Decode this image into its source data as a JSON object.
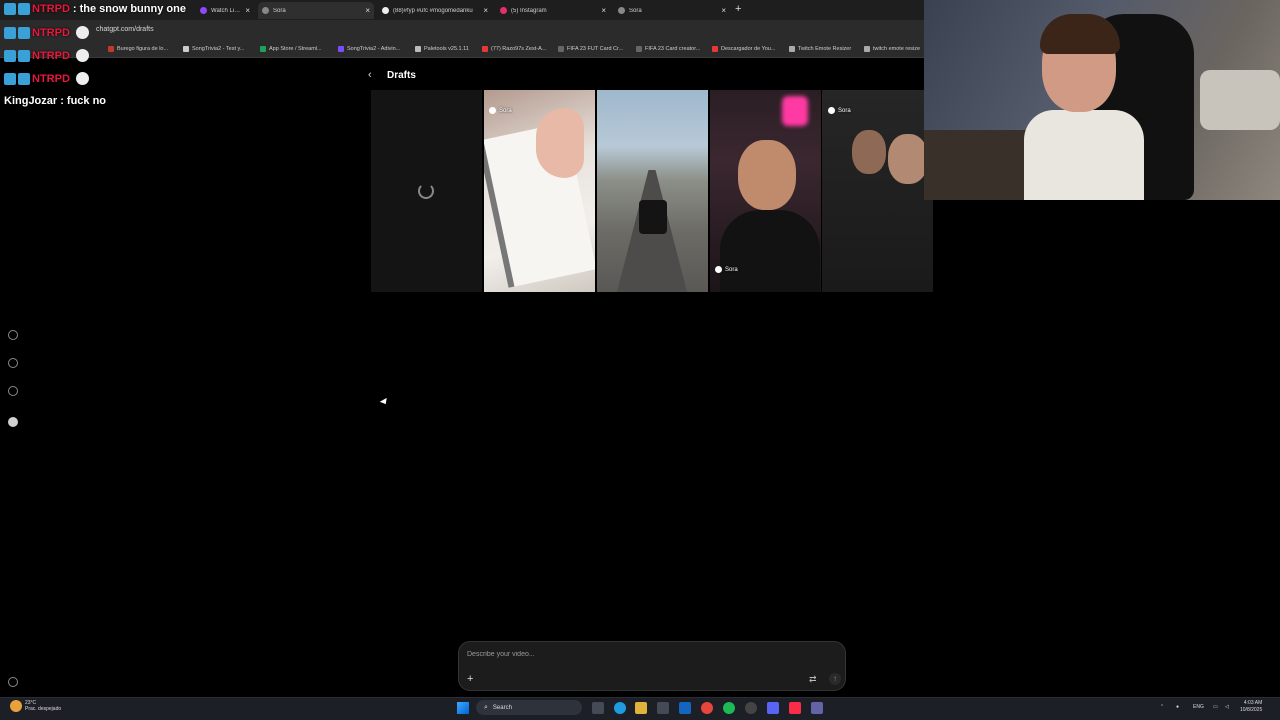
{
  "browser": {
    "tabs": [
      {
        "title": "Watch Live o",
        "color": "#9146ff"
      },
      {
        "title": "Sora",
        "color": "#888888"
      },
      {
        "title": "(88)#fyp #ufc #mogomedanku",
        "color": "#eeeeee"
      },
      {
        "title": "(5) Instagram",
        "color": "#e1306c"
      },
      {
        "title": "Sora",
        "color": "#888888"
      }
    ],
    "new_tab": "+",
    "url": "chatgpt.com/drafts",
    "bookmarks": [
      {
        "label": "Burego figura de lo...",
        "color": "#c0392b"
      },
      {
        "label": "SongTrivia2 - Test y...",
        "color": "#cccccc"
      },
      {
        "label": "App Store / Streaml...",
        "color": "#1aa35c"
      },
      {
        "label": "SongTrivia2 - Adivin...",
        "color": "#7c4dff"
      },
      {
        "label": "Paletools v25.1.11",
        "color": "#bbbbbb"
      },
      {
        "label": "(77) Razo97s Zest-A...",
        "color": "#e53935"
      },
      {
        "label": "FIFA 23 FUT Card Cr...",
        "color": "#666666"
      },
      {
        "label": "FIFA 23 Card creator...",
        "color": "#666666"
      },
      {
        "label": "Descargador de You...",
        "color": "#e53935"
      },
      {
        "label": "Twitch Emote Resizer",
        "color": "#aaaaaa"
      },
      {
        "label": "twitch emote resize",
        "color": "#aaaaaa"
      }
    ]
  },
  "chat": {
    "messages": [
      {
        "user": "NTRPD",
        "text": ": the snow bunny one"
      },
      {
        "user": "NTRPD",
        "text": ""
      },
      {
        "user": "NTRPD",
        "text": ""
      },
      {
        "user": "NTRPD",
        "text": ""
      },
      {
        "user": "KingJozar",
        "text": ": fuck no"
      }
    ]
  },
  "app": {
    "back_icon": "chevron-left-icon",
    "title": "Drafts",
    "watermark": "Sora",
    "composer": {
      "placeholder": "Describe your video...",
      "plus": "+",
      "settings": "⇄",
      "send": "↑"
    }
  },
  "taskbar": {
    "weather_temp": "23°C",
    "weather_desc": "Prac. despejado",
    "search_label": "Search",
    "language": "ENG",
    "time": "4:03 AM",
    "date": "10/8/2025",
    "apps": [
      {
        "name": "file-explorer",
        "color": "#f2c14e"
      },
      {
        "name": "edge",
        "color": "#1f9be0"
      },
      {
        "name": "folder",
        "color": "#e0b33a"
      },
      {
        "name": "store",
        "color": "#444b57"
      },
      {
        "name": "outlook",
        "color": "#1465c0"
      },
      {
        "name": "chrome",
        "color": "#e8453c"
      },
      {
        "name": "spotify",
        "color": "#1db954"
      },
      {
        "name": "obs",
        "color": "#444444"
      },
      {
        "name": "discord",
        "color": "#5865f2"
      },
      {
        "name": "music",
        "color": "#fa2d48"
      },
      {
        "name": "teams",
        "color": "#6264a7"
      }
    ]
  }
}
